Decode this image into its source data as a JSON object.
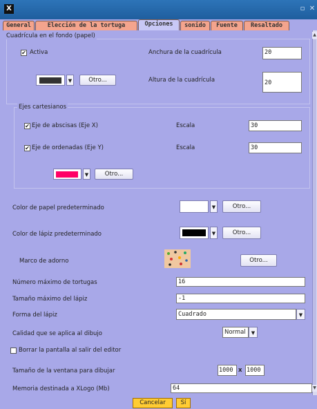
{
  "tabs": [
    "General",
    "Elección de la tortuga",
    "Opciones",
    "sonido",
    "Fuente",
    "Resaltado"
  ],
  "grid": {
    "group_title": "Cuadrícula en el fondo (papel)",
    "active_label": "Activa",
    "active_checked": true,
    "width_label": "Anchura de la cuadrícula",
    "width_value": "20",
    "height_label": "Altura de la cuadrícula",
    "height_value": "20",
    "color": "#333333",
    "other_label": "Otro..."
  },
  "axes": {
    "group_title": "Ejes cartesianos",
    "x_label": "Eje de abscisas (Eje X)",
    "x_checked": true,
    "x_scale_label": "Escala",
    "x_scale_value": "30",
    "y_label": "Eje de ordenadas (Eje Y)",
    "y_checked": true,
    "y_scale_label": "Escala",
    "y_scale_value": "30",
    "color": "#ff0066",
    "other_label": "Otro..."
  },
  "paper_color": {
    "label": "Color de papel predeterminado",
    "color": "#ffffff",
    "other_label": "Otro..."
  },
  "pen_color": {
    "label": "Color de lápiz predeterminado",
    "color": "#000000",
    "other_label": "Otro..."
  },
  "frame": {
    "label": "Marco de adorno",
    "other_label": "Otro..."
  },
  "max_turtles": {
    "label": "Número máximo de tortugas",
    "value": "16"
  },
  "max_pen": {
    "label": "Tamaño máximo del lápiz",
    "value": "-1"
  },
  "pen_shape": {
    "label": "Forma del lápiz",
    "value": "Cuadrado"
  },
  "quality": {
    "label": "Calidad que se aplica al dibujo",
    "value": "Normal"
  },
  "clear_screen": {
    "label": "Borrar la pantalla al salir del editor",
    "checked": false
  },
  "window_size": {
    "label": "Tamaño de la ventana para dibujar",
    "width": "1000",
    "x": "x",
    "height": "1000"
  },
  "memory": {
    "label": "Memoria destinada a XLogo (Mb)",
    "value": "64"
  },
  "buttons": {
    "cancel": "Cancelar",
    "ok": "Sí"
  }
}
